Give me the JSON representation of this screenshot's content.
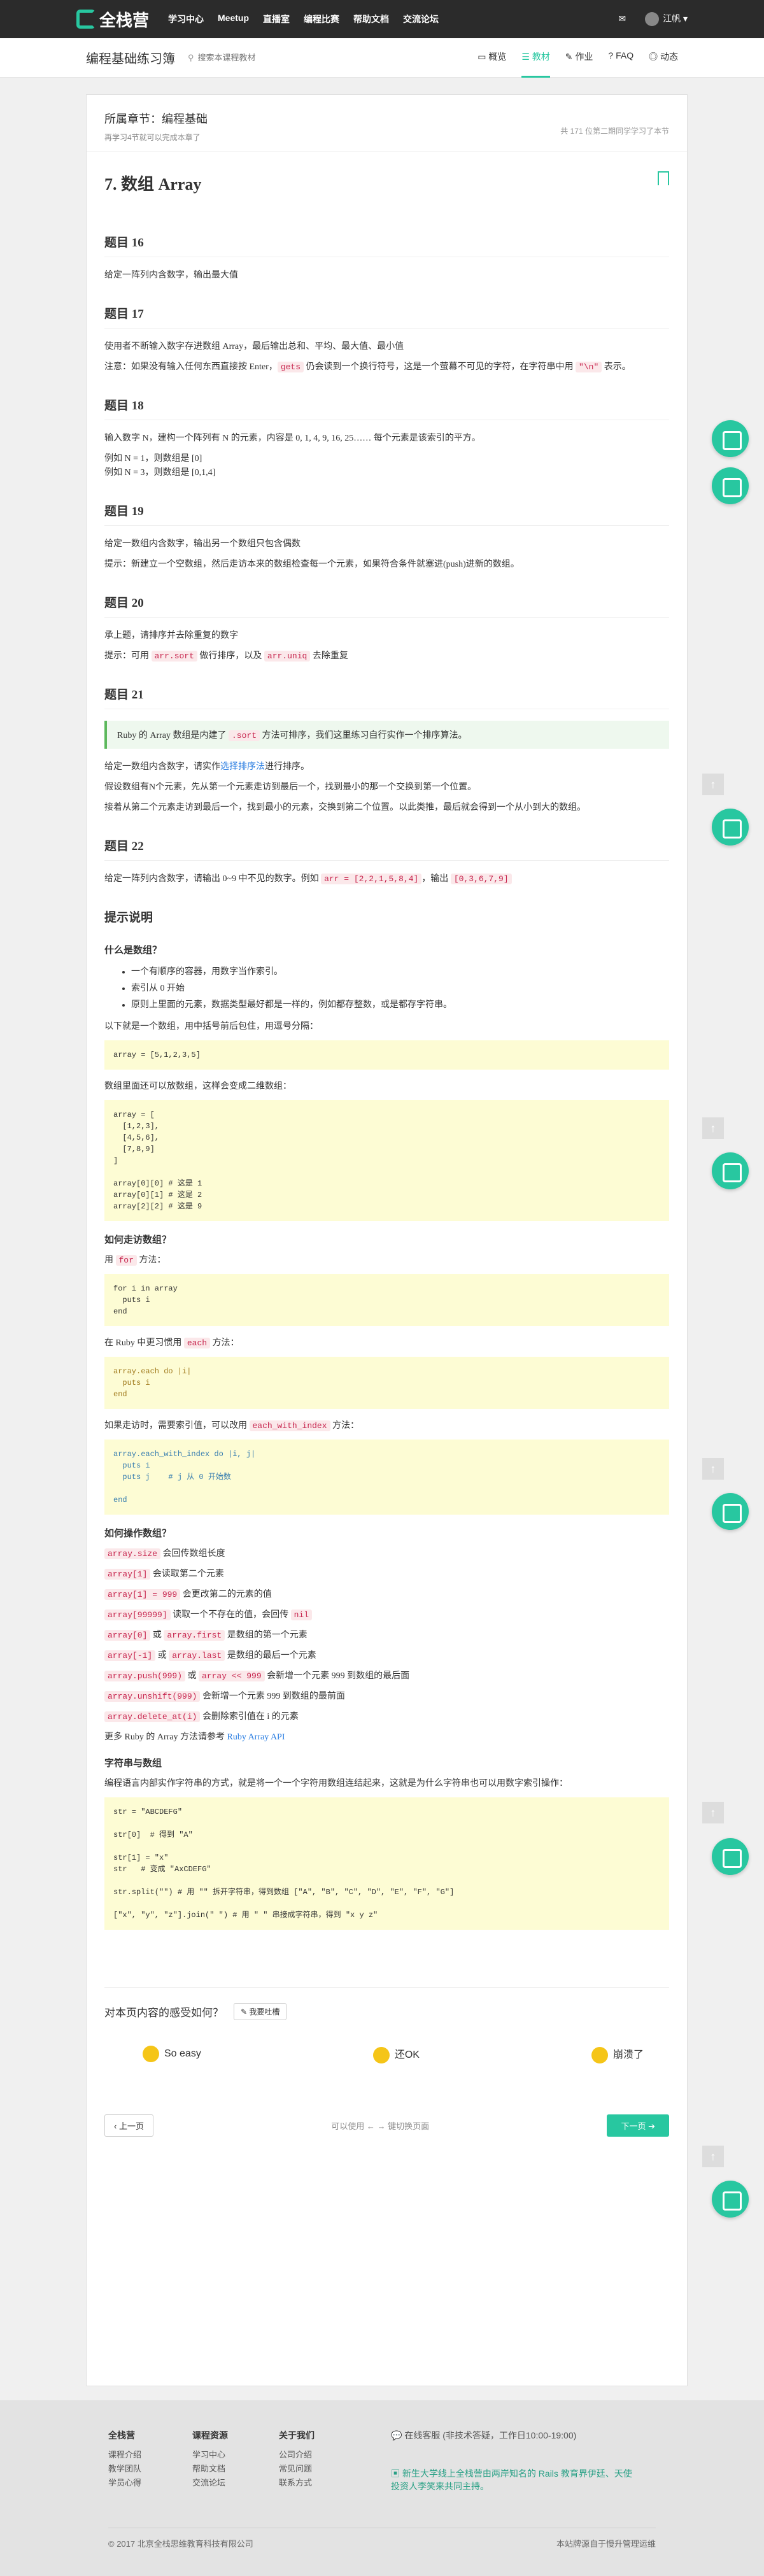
{
  "nav": {
    "logo": "全栈营",
    "links": [
      "学习中心",
      "Meetup",
      "直播室",
      "编程比赛",
      "帮助文档",
      "交流论坛"
    ],
    "user": "江帆"
  },
  "subheader": {
    "title": "编程基础练习簿",
    "search_placeholder": "搜索本课程教材",
    "tabs": [
      "概览",
      "教材",
      "作业",
      "FAQ",
      "动态"
    ]
  },
  "chapter": {
    "name": "所属章节：编程基础",
    "hint": "再学习4节就可以完成本章了",
    "stats": "共 171 位第二期同学学习了本节"
  },
  "lesson": {
    "title": "7. 数组 Array",
    "q16_title": "题目 16",
    "q16_text": "给定一阵列内含数字，输出最大值",
    "q17_title": "题目 17",
    "q17_text": "使用者不断输入数字存进数组 Array，最后输出总和、平均、最大值、最小值",
    "q17_note_a": "注意：如果没有输入任何东西直接按 Enter，",
    "q17_note_code1": "gets",
    "q17_note_b": " 仍会读到一个换行符号，这是一个萤幕不可见的字符，在字符串中用 ",
    "q17_note_code2": "\"\\n\"",
    "q17_note_c": " 表示。",
    "q18_title": "题目 18",
    "q18_text": "输入数字 N，建构一个阵列有 N 的元素，内容是 0, 1, 4, 9, 16, 25…… 每个元素是该索引的平方。",
    "q18_ex1": "例如 N = 1，则数组是 [0]",
    "q18_ex2": "例如 N = 3，则数组是 [0,1,4]",
    "q19_title": "题目 19",
    "q19_text": "给定一数组内含数字，输出另一个数组只包含偶数",
    "q19_hint": "提示：新建立一个空数组，然后走访本来的数组检查每一个元素，如果符合条件就塞进(push)进新的数组。",
    "q20_title": "题目 20",
    "q20_text": "承上题，请排序并去除重复的数字",
    "q20_hint_a": "提示：可用 ",
    "q20_hint_code1": "arr.sort",
    "q20_hint_b": " 做行排序，以及 ",
    "q20_hint_code2": "arr.uniq",
    "q20_hint_c": " 去除重复",
    "q21_title": "题目 21",
    "q21_note_a": "Ruby 的 Array 数组是内建了 ",
    "q21_note_code": ".sort",
    "q21_note_b": " 方法可排序，我们这里练习自行实作一个排序算法。",
    "q21_text_a": "给定一数组内含数字，请实作",
    "q21_link": "选择排序法",
    "q21_text_b": "进行排序。",
    "q21_p2": "假设数组有N个元素，先从第一个元素走访到最后一个，找到最小的那一个交换到第一个位置。",
    "q21_p3": "接着从第二个元素走访到最后一个，找到最小的元素，交换到第二个位置。以此类推，最后就会得到一个从小到大的数组。",
    "q22_title": "题目 22",
    "q22_text_a": "给定一阵列内含数字，请输出 0~9 中不见的数字。例如 ",
    "q22_code1": "arr = [2,2,1,5,8,4]",
    "q22_text_b": "，输出 ",
    "q22_code2": "[0,3,6,7,9]",
    "tips_title": "提示说明",
    "what_title": "什么是数组？",
    "what_items": [
      "一个有顺序的容器，用数字当作索引。",
      "索引从 0 开始",
      "原则上里面的元素，数据类型最好都是一样的，例如都存整数，或是都存字符串。"
    ],
    "what_p": "以下就是一个数组，用中括号前后包住，用逗号分隔：",
    "code1": "array = [5,1,2,3,5]",
    "nest_p": "数组里面还可以放数组，这样会变成二维数组：",
    "code2": "array = [\n  [1,2,3],\n  [4,5,6],\n  [7,8,9]\n]\n\narray[0][0] # 这是 1\narray[0][1] # 这是 2\narray[2][2] # 这是 9",
    "iter_title": "如何走访数组？",
    "iter_p_a": "用 ",
    "iter_p_code": "for",
    "iter_p_b": " 方法：",
    "code3": "for i in array\n  puts i\nend",
    "each_p_a": "在 Ruby 中更习惯用 ",
    "each_p_code": "each",
    "each_p_b": " 方法：",
    "code4": "array.each do |i|\n  puts i\nend",
    "ewi_p_a": "如果走访时，需要索引值，可以改用 ",
    "ewi_p_code": "each_with_index",
    "ewi_p_b": " 方法：",
    "code5": "array.each_with_index do |i, j|\n  puts i\n  puts j    # j 从 0 开始数\n\nend",
    "ops_title": "如何操作数组？",
    "ops": [
      {
        "code": "array.size",
        "text": " 会回传数组长度"
      },
      {
        "code": "array[1]",
        "text": " 会读取第二个元素"
      },
      {
        "code": "array[1] = 999",
        "text": " 会更改第二的元素的值"
      },
      {
        "code": "array[99999]",
        "text": " 读取一个不存在的值，会回传 ",
        "code2": "nil"
      },
      {
        "code": "array[0]",
        "text": " 或 ",
        "code2": "array.first",
        "text2": " 是数组的第一个元素"
      },
      {
        "code": "array[-1]",
        "text": " 或 ",
        "code2": "array.last",
        "text2": " 是数组的最后一个元素"
      },
      {
        "code": "array.push(999)",
        "text": " 或 ",
        "code2": "array << 999",
        "text2": " 会新增一个元素 999 到数组的最后面"
      },
      {
        "code": "array.unshift(999)",
        "text": " 会新增一个元素 999 到数组的最前面"
      },
      {
        "code": "array.delete_at(i)",
        "text": " 会删除索引值在 i 的元素"
      }
    ],
    "more_a": "更多 Ruby 的 Array 方法请参考 ",
    "more_link": "Ruby Array API",
    "str_title": "字符串与数组",
    "str_p": "编程语言内部实作字符串的方式，就是将一个一个字符用数组连结起来，这就是为什么字符串也可以用数字索引操作：",
    "code6": "str = \"ABCDEFG\"\n\nstr[0]  # 得到 \"A\"\n\nstr[1] = \"x\"\nstr   # 变成 \"AxCDEFG\"\n\nstr.split(\"\") # 用 \"\" 拆开字符串，得到数组 [\"A\", \"B\", \"C\", \"D\", \"E\", \"F\", \"G\"]\n\n[\"x\", \"y\", \"z\"].join(\" \") # 用 \" \" 串接成字符串，得到 \"x y z\""
  },
  "feedback": {
    "question": "对本页内容的感受如何？",
    "report": "我要吐槽",
    "votes": [
      "So easy",
      "还OK",
      "崩溃了"
    ]
  },
  "pager": {
    "prev": "上一页",
    "middle": "可以使用 ← → 键切换页面",
    "next": "下一页"
  },
  "footer": {
    "cols": [
      {
        "title": "全栈营",
        "items": [
          "课程介绍",
          "教学团队",
          "学员心得"
        ]
      },
      {
        "title": "课程资源",
        "items": [
          "学习中心",
          "帮助文档",
          "交流论坛"
        ]
      },
      {
        "title": "关于我们",
        "items": [
          "公司介绍",
          "常见问题",
          "联系方式"
        ]
      }
    ],
    "service": "在线客服 (非技术答疑，工作日10:00-19:00)",
    "promo": "新生大学线上全栈营由两岸知名的 Rails 教育界伊廷、天使投资人李笑来共同主持。",
    "copyright": "© 2017 北京全栈思维教育科技有限公司",
    "icp": "本站牌源自于慢升管理运维"
  }
}
